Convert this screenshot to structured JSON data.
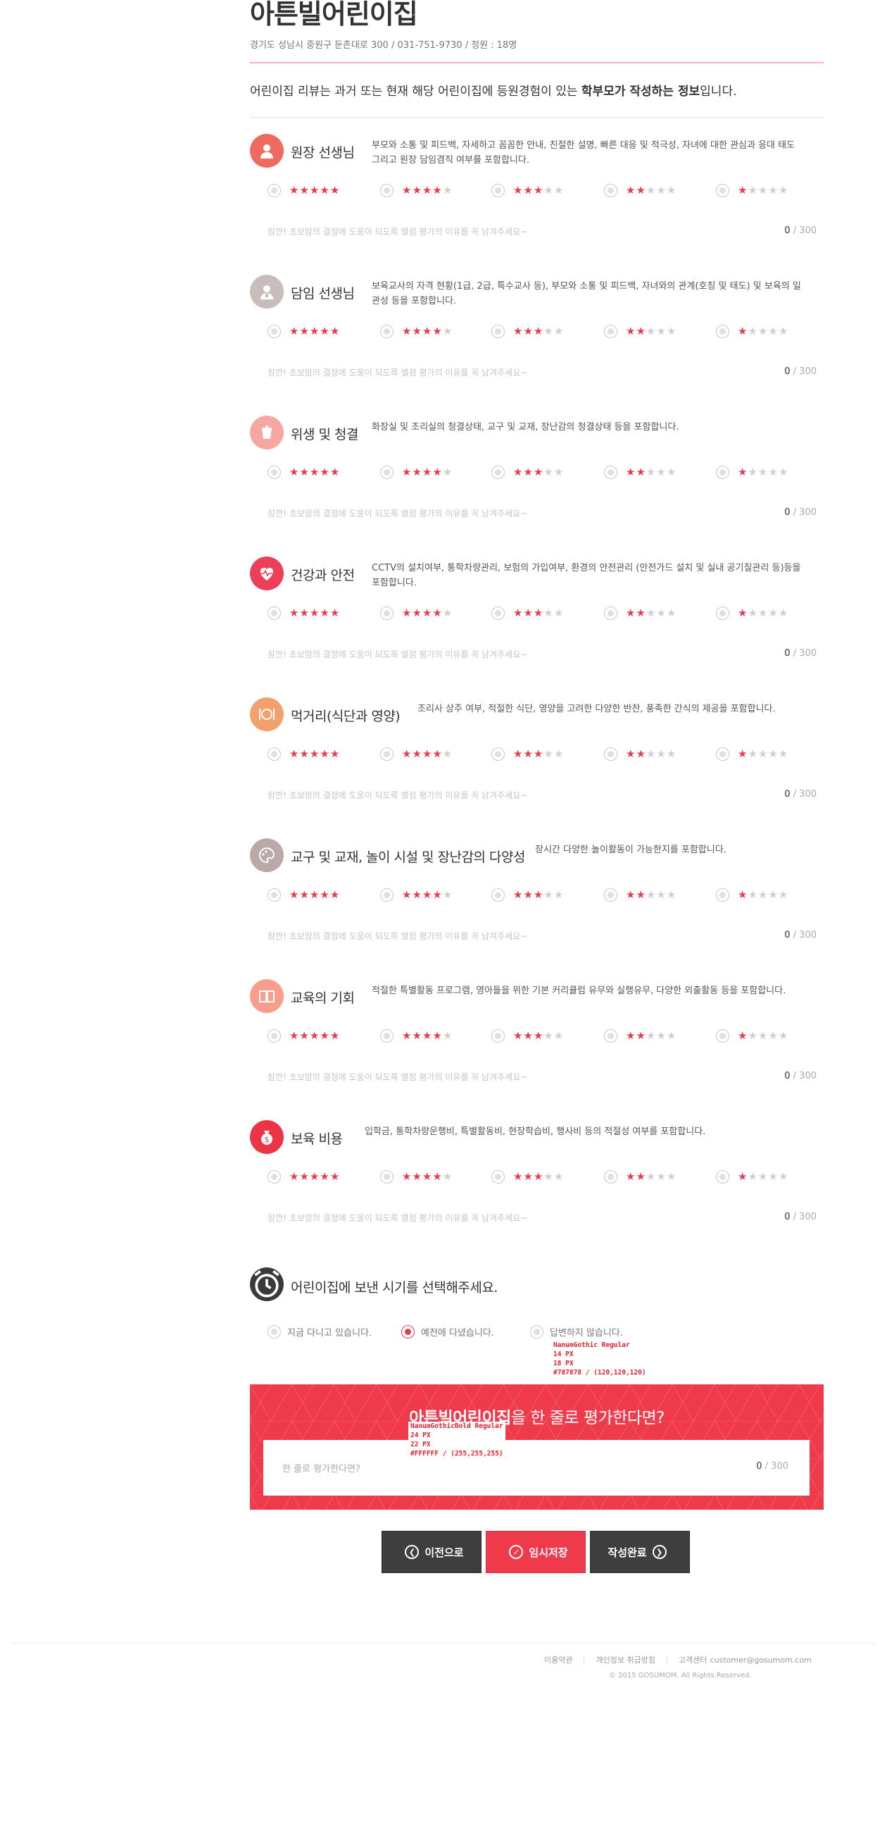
{
  "header": {
    "title": "아튼빌어린이집",
    "address": "경기도 성남시 중원구 둔촌대로 300 / 031-751-9730 / 정원 : 18명",
    "intro_pre": "어린이집 리뷰는 과거 또는 현재 해당 어린이집에 등원경험이 있는 ",
    "intro_bold": "학부모가 작성하는 정보",
    "intro_post": "입니다."
  },
  "rating_levels": [
    5,
    4,
    3,
    2,
    1
  ],
  "comment_placeholder": "잠깐! 초보맘의 결정에 도움이 되도록 별점 평가의 이유를 꼭 남겨주세요~",
  "comment_count": "0",
  "comment_max": " / 300",
  "sections": [
    {
      "icon": "user-icon",
      "color": "#ef6a5f",
      "name": "원장 선생님",
      "desc": "부모와 소통 및 피드백, 자세하고 꼼꼼한 안내, 친절한 설명, 빠른 대응 및 적극성, 자녀에 대한 관심과 응대 태도 그리고 원장 담임겸직 여부를 포함합니다."
    },
    {
      "icon": "teacher-icon",
      "color": "#c9bcbb",
      "name": "담임 선생님",
      "desc": "보육교사의 자격 현황(1급, 2급, 특수교사 등), 부모와 소통 및 피드백, 자녀와의 관계(호칭 및 태도) 및 보육의 일관성 등을 포함합니다."
    },
    {
      "icon": "broom-icon",
      "color": "#f8a7a0",
      "name": "위생 및 청결",
      "desc": "화장실 및 조리실의 청결상태, 교구 및 교재, 장난감의 청결상태 등을 포함합니다."
    },
    {
      "icon": "heartbeat-icon",
      "color": "#ee3f58",
      "name": "건강과 안전",
      "desc": "CCTV의 설치여부, 통학차량관리, 보험의 가입여부, 환경의 안전관리 (안전가드 설치 및 실내 공기질관리 등)등을 포함합니다."
    },
    {
      "icon": "meal-icon",
      "color": "#f4a06c",
      "name": "먹거리(식단과 영양)",
      "desc": "조리사 상주 여부, 적절한 식단, 영양을 고려한 다양한 반찬, 풍족한 간식의 제공을 포함합니다."
    },
    {
      "icon": "palette-icon",
      "color": "#bba9a9",
      "name": "교구 및 교재, 놀이 시설 및 장난감의 다양성",
      "desc": "장시간 다양한 놀이활동이 가능한지를 포함합니다."
    },
    {
      "icon": "book-icon",
      "color": "#f79e8d",
      "name": "교육의 기회",
      "desc": "적절한 특별활동 프로그램, 영아들을 위한 기본 커리큘럼 유무와 실행유무, 다양한 외출활동 등을 포함합니다."
    },
    {
      "icon": "money-bag-icon",
      "color": "#ec3447",
      "name": "보육 비용",
      "desc": "입학금, 통학차량운행비, 특별활동비, 현장학습비, 행사비 등의 적절성 여부를 포함합니다."
    }
  ],
  "when": {
    "question": "어린이집에 보낸 시기를 선택해주세요.",
    "options": [
      "지금 다니고 있습니다.",
      "예전에 다녔습니다.",
      "답변하지 않습니다."
    ],
    "selected": 1
  },
  "annotations": {
    "a1": [
      "NanumGothic Regular",
      "14 PX",
      "18 PX",
      "#787878 / (120,120,120)"
    ],
    "a2": [
      "NanumGothicBold Regular",
      "24 PX",
      "22 PX",
      "#FFFFFF / (255,255,255)"
    ]
  },
  "oneline": {
    "name": "아튼빌어린이집",
    "suffix": "을 한 줄로 평가한다면?",
    "placeholder": "한 줄로 평가한다면?",
    "count": "0",
    "max": " / 300"
  },
  "buttons": {
    "prev": "이전으로",
    "save": "임시저장",
    "done": "작성완료"
  },
  "footer": {
    "terms": "이용약관",
    "privacy": "개인정보 취급방침",
    "support": "고객센터",
    "email": "customer@gosumom.com",
    "copyright": "© 2015 GOSUMOM. All Rights Reserved."
  },
  "colors": {
    "accent": "#ec3a4d",
    "dark_button": "#3e3e3e",
    "text_grey": "#787878"
  }
}
